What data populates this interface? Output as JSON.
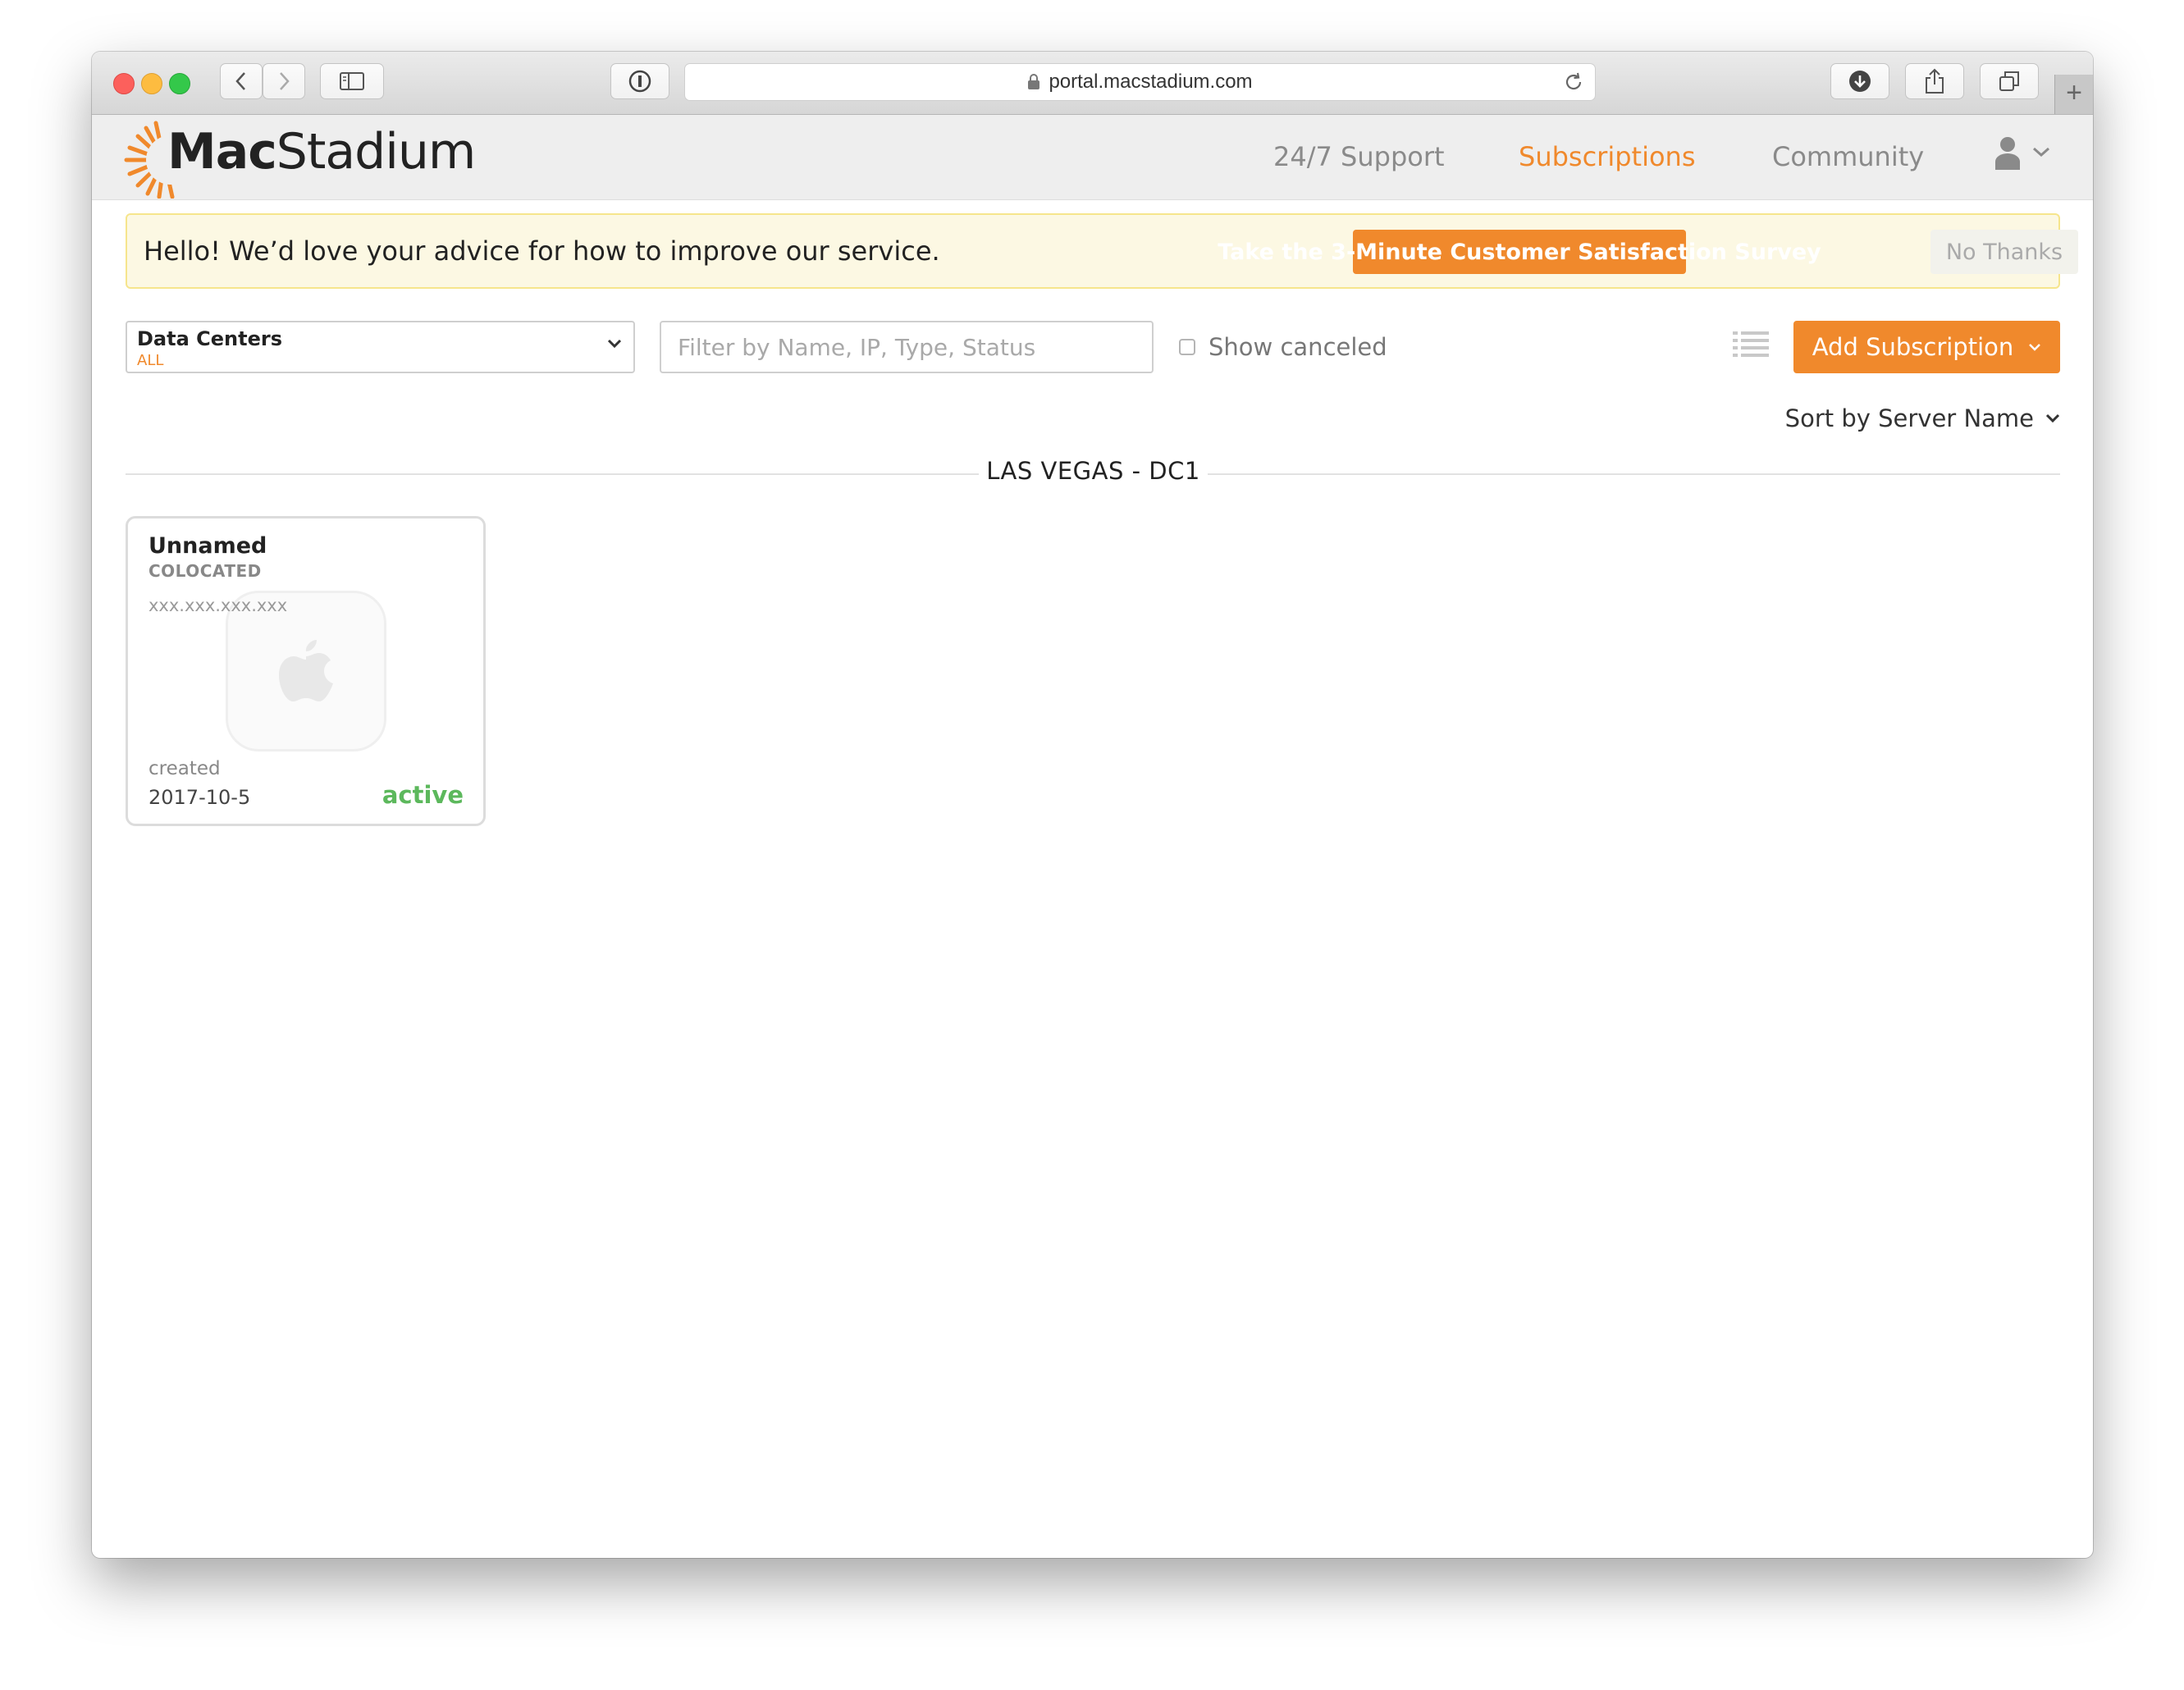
{
  "browser": {
    "url": "portal.macstadium.com"
  },
  "header": {
    "logo": {
      "bold": "Mac",
      "light": "Stadium"
    },
    "nav": [
      {
        "label": "24/7 Support",
        "active": false
      },
      {
        "label": "Subscriptions",
        "active": true
      },
      {
        "label": "Community",
        "active": false
      }
    ]
  },
  "banner": {
    "text": "Hello! We’d love your advice for how to improve our service.",
    "survey_label": "Take the 3-Minute Customer Satisfaction Survey",
    "dismiss_label": "No Thanks"
  },
  "filters": {
    "datacenters_label": "Data Centers",
    "datacenters_value": "ALL",
    "search_placeholder": "Filter by Name, IP, Type, Status",
    "search_value": "",
    "show_canceled_label": "Show canceled",
    "show_canceled_checked": false,
    "add_subscription_label": "Add Subscription",
    "sort_label": "Sort by Server Name"
  },
  "datacenters": [
    {
      "name": "LAS VEGAS - DC1",
      "servers": [
        {
          "name": "Unnamed",
          "type": "COLOCATED",
          "ip": "xxx.xxx.xxx.xxx",
          "created_label": "created",
          "created": "2017-10-5",
          "status": "active"
        }
      ]
    }
  ],
  "colors": {
    "accent": "#f0892c",
    "status_active": "#5cb85c",
    "banner_bg": "#fcf8e3"
  },
  "icons": {
    "lock": "lock-icon",
    "reload": "reload-icon",
    "user": "user-icon",
    "list_view": "list-view-icon",
    "apple": "apple-logo-icon"
  }
}
